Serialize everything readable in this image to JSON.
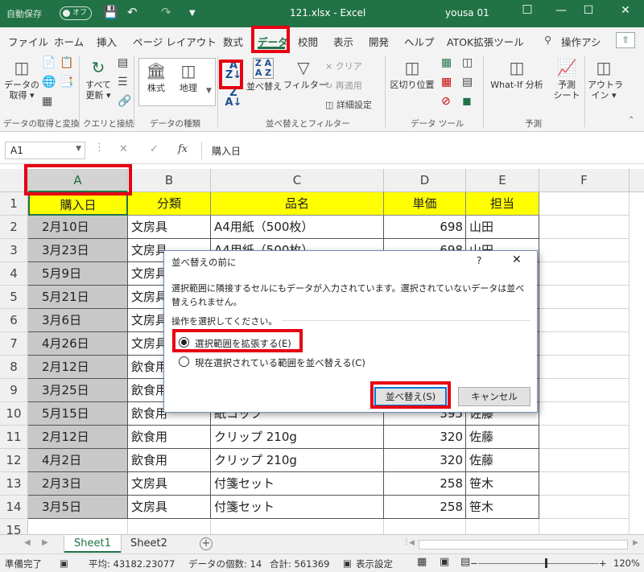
{
  "titlebar": {
    "autosave_label": "自動保存",
    "autosave_state": "オフ",
    "save_icon": "save-icon",
    "undo_icon": "undo-icon",
    "redo_icon": "redo-icon",
    "document": "121.xlsx  -  Excel",
    "user": "yousa 01"
  },
  "menu": {
    "tabs": [
      "ファイル",
      "ホーム",
      "挿入",
      "ページ レイアウト",
      "数式",
      "データ",
      "校閲",
      "表示",
      "開発",
      "ヘルプ",
      "ATOK拡張ツール",
      "操作アシ"
    ],
    "active": "データ"
  },
  "ribbon": {
    "get_data": "データの\n取得 ▾",
    "refresh_all": "すべて\n更新 ▾",
    "stocks": "株式",
    "geography": "地理",
    "sort": "並べ替え",
    "filter": "フィルター",
    "clear": "クリア",
    "reapply": "再適用",
    "advanced": "詳細設定",
    "text_to_columns": "区切り位置",
    "whatif": "What-If 分析",
    "forecast_sheet": "予測\nシート",
    "outline": "アウトラ\nイン ▾",
    "groups": [
      "データの取得と変換",
      "クエリと接続",
      "データの種類",
      "並べ替えとフィルター",
      "データ ツール",
      "予測"
    ]
  },
  "formula_bar": {
    "name_box": "A1",
    "content": "購入日"
  },
  "grid": {
    "columns": [
      "A",
      "B",
      "C",
      "D",
      "E",
      "F"
    ],
    "header": [
      "購入日",
      "分類",
      "品名",
      "単価",
      "担当"
    ],
    "rows": [
      {
        "n": "2",
        "a": "2月10日",
        "b": "文房具",
        "c": "A4用紙（500枚）",
        "d": "698",
        "e": "山田"
      },
      {
        "n": "3",
        "a": "3月23日",
        "b": "文房具",
        "c": "A4用紙（500枚）",
        "d": "698",
        "e": "山田"
      },
      {
        "n": "4",
        "a": "5月9日",
        "b": "文房具",
        "c": "",
        "d": "",
        "e": ""
      },
      {
        "n": "5",
        "a": "5月21日",
        "b": "文房具",
        "c": "",
        "d": "",
        "e": ""
      },
      {
        "n": "6",
        "a": "3月6日",
        "b": "文房具",
        "c": "",
        "d": "",
        "e": ""
      },
      {
        "n": "7",
        "a": "4月26日",
        "b": "文房具",
        "c": "",
        "d": "",
        "e": ""
      },
      {
        "n": "8",
        "a": "2月12日",
        "b": "飲食用",
        "c": "",
        "d": "",
        "e": ""
      },
      {
        "n": "9",
        "a": "3月25日",
        "b": "飲食用",
        "c": "",
        "d": "",
        "e": ""
      },
      {
        "n": "10",
        "a": "5月15日",
        "b": "飲食用",
        "c": "紙コップ",
        "d": "395",
        "e": "佐藤"
      },
      {
        "n": "11",
        "a": "2月12日",
        "b": "飲食用",
        "c": "クリップ 210g",
        "d": "320",
        "e": "佐藤"
      },
      {
        "n": "12",
        "a": "4月2日",
        "b": "飲食用",
        "c": "クリップ 210g",
        "d": "320",
        "e": "佐藤"
      },
      {
        "n": "13",
        "a": "2月3日",
        "b": "文房具",
        "c": "付箋セット",
        "d": "258",
        "e": "笹木"
      },
      {
        "n": "14",
        "a": "3月5日",
        "b": "文房具",
        "c": "付箋セット",
        "d": "258",
        "e": "笹木"
      },
      {
        "n": "15",
        "a": "",
        "b": "",
        "c": "",
        "d": "",
        "e": ""
      }
    ]
  },
  "sheets": [
    "Sheet1",
    "Sheet2"
  ],
  "status": {
    "mode": "準備完了",
    "average": "平均: 43182.23077",
    "count": "データの個数: 14",
    "sum": "合計: 561369",
    "display_settings": "表示設定",
    "zoom": "120%"
  },
  "dialog": {
    "title": "並べ替えの前に",
    "help": "?",
    "close": "✕",
    "message": "選択範囲に隣接するセルにもデータが入力されています。選択されていないデータは並べ替えられません。",
    "prompt": "操作を選択してください。",
    "option1": "選択範囲を拡張する(E)",
    "option2": "現在選択されている範囲を並べ替える(C)",
    "sort_button": "並べ替え(S)",
    "cancel_button": "キャンセル"
  },
  "colors": {
    "excel_green": "#217346",
    "header_fill": "#ffff00",
    "highlight_red": "#e60012"
  }
}
